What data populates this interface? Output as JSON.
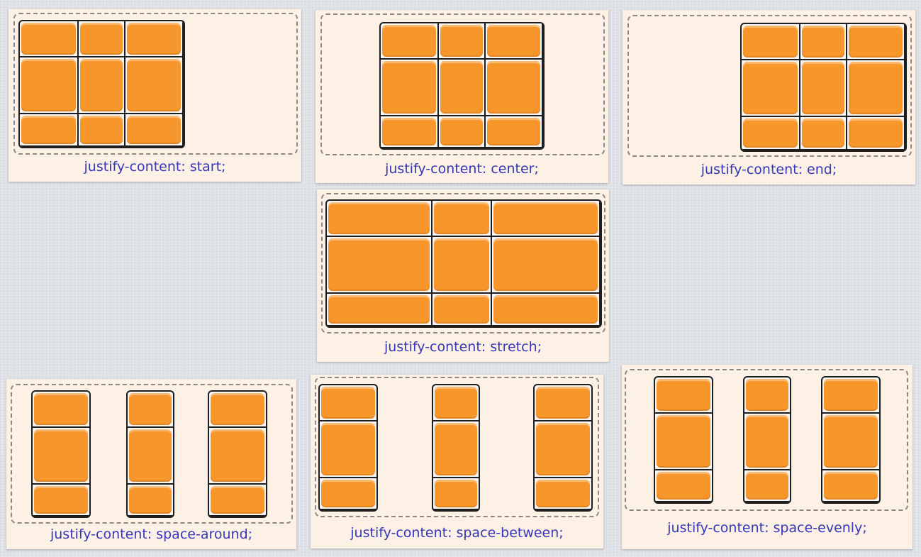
{
  "diagrams": [
    {
      "caption": "justify-content: start;"
    },
    {
      "caption": "justify-content: center;"
    },
    {
      "caption": "justify-content: end;"
    },
    {
      "caption": "justify-content: stretch;"
    },
    {
      "caption": "justify-content: space-around;"
    },
    {
      "caption": "justify-content: space-between;"
    },
    {
      "caption": "justify-content: space-evenly;"
    }
  ],
  "colors": {
    "item_fill": "#f7962a",
    "panel_background": "#fdf1e6",
    "caption_text": "#3536b8",
    "grid_line": "#1e1e1e"
  }
}
